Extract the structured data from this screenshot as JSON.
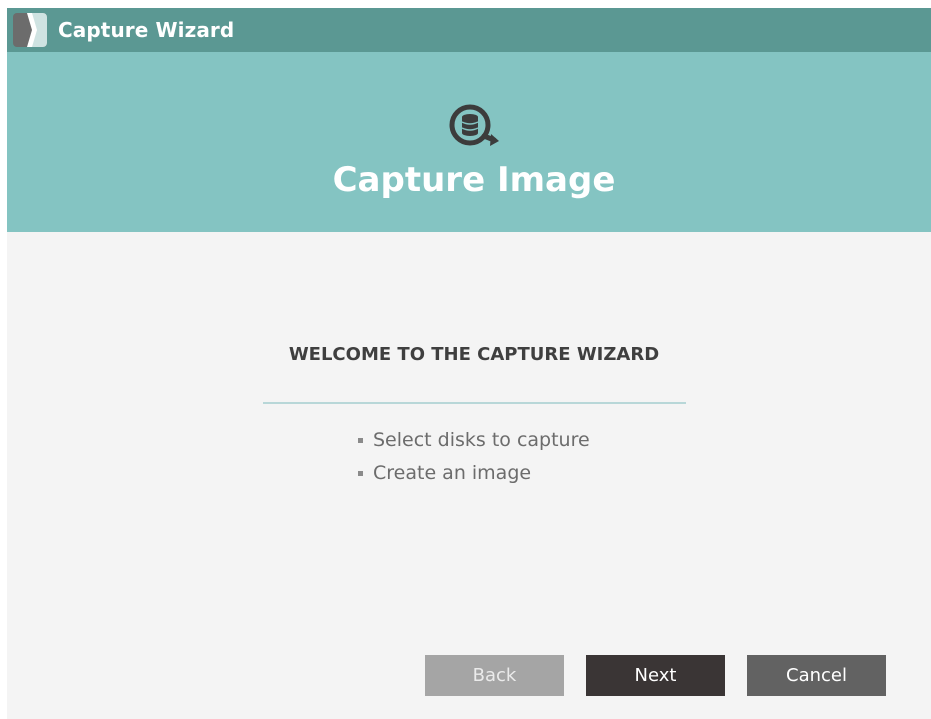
{
  "window": {
    "title": "Capture Wizard",
    "logo_icon": "app-logo-icon"
  },
  "header": {
    "icon": "capture-disk-icon",
    "title": "Capture Image",
    "background_color": "#84c4c2",
    "titlebar_color": "#5b9893"
  },
  "content": {
    "heading": "WELCOME TO THE CAPTURE WIZARD",
    "steps": [
      {
        "label": "Select disks to capture"
      },
      {
        "label": "Create an image"
      }
    ]
  },
  "footer": {
    "back_label": "Back",
    "back_enabled": false,
    "next_label": "Next",
    "cancel_label": "Cancel"
  }
}
